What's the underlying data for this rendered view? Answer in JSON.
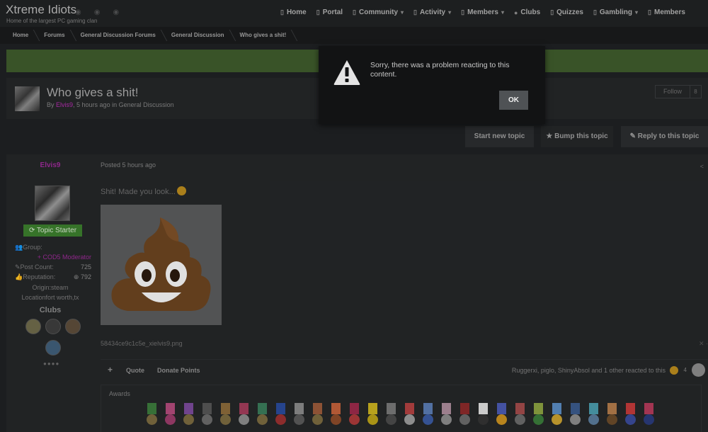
{
  "site": {
    "title": "Xtreme Idiots",
    "tagline": "Home of the largest PC gaming clan"
  },
  "nav": [
    {
      "label": "Home",
      "icon": "page-icon",
      "caret": false
    },
    {
      "label": "Portal",
      "icon": "page-icon",
      "caret": false
    },
    {
      "label": "Community",
      "icon": "page-icon",
      "caret": true
    },
    {
      "label": "Activity",
      "icon": "page-icon",
      "caret": true
    },
    {
      "label": "Members",
      "icon": "page-icon",
      "caret": true
    },
    {
      "label": "Clubs",
      "icon": "users-icon",
      "caret": false
    },
    {
      "label": "Quizzes",
      "icon": "page-icon",
      "caret": false
    },
    {
      "label": "Gambling",
      "icon": "page-icon",
      "caret": true
    },
    {
      "label": "Members",
      "icon": "page-icon",
      "caret": false
    }
  ],
  "breadcrumb": [
    "Home",
    "Forums",
    "General Discussion Forums",
    "General Discussion",
    "Who gives a shit!"
  ],
  "topic": {
    "title": "Who gives a shit!",
    "meta_by": "By ",
    "author": "Elvis9",
    "meta_rest": ", 5 hours ago in General Discussion",
    "follow_label": "Follow",
    "follow_count": "8"
  },
  "actions": {
    "start": "Start new topic",
    "bump": "Bump this topic",
    "reply": "Reply to this topic"
  },
  "post": {
    "author": "Elvis9",
    "badge": "Topic Starter",
    "group_label": "Group:",
    "group_value": "+ COD5 Moderator",
    "post_count_label": "Post Count:",
    "post_count": "725",
    "reputation_label": "Reputation:",
    "reputation": "792",
    "origin": "Origin:steam",
    "location": "Locationfort worth,tx",
    "clubs_title": "Clubs",
    "posted": "Posted 5 hours ago",
    "text": "Shit! Made you look...",
    "file_name": "58434ce9c1c5e_xielvis9.png",
    "quote_label": "Quote",
    "donate_label": "Donate Points",
    "reactions_text": "Ruggerxi, piglo, ShinyAbsol and 1 other reacted to this",
    "reaction_count": "4",
    "awards_label": "Awards"
  },
  "dialog": {
    "message": "Sorry, there was a problem reacting to this content.",
    "ok_label": "OK"
  },
  "colors": {
    "accent_purple": "#9c2b97",
    "banner_green": "#3e5b2c",
    "badge_green": "#3b7d2d"
  }
}
